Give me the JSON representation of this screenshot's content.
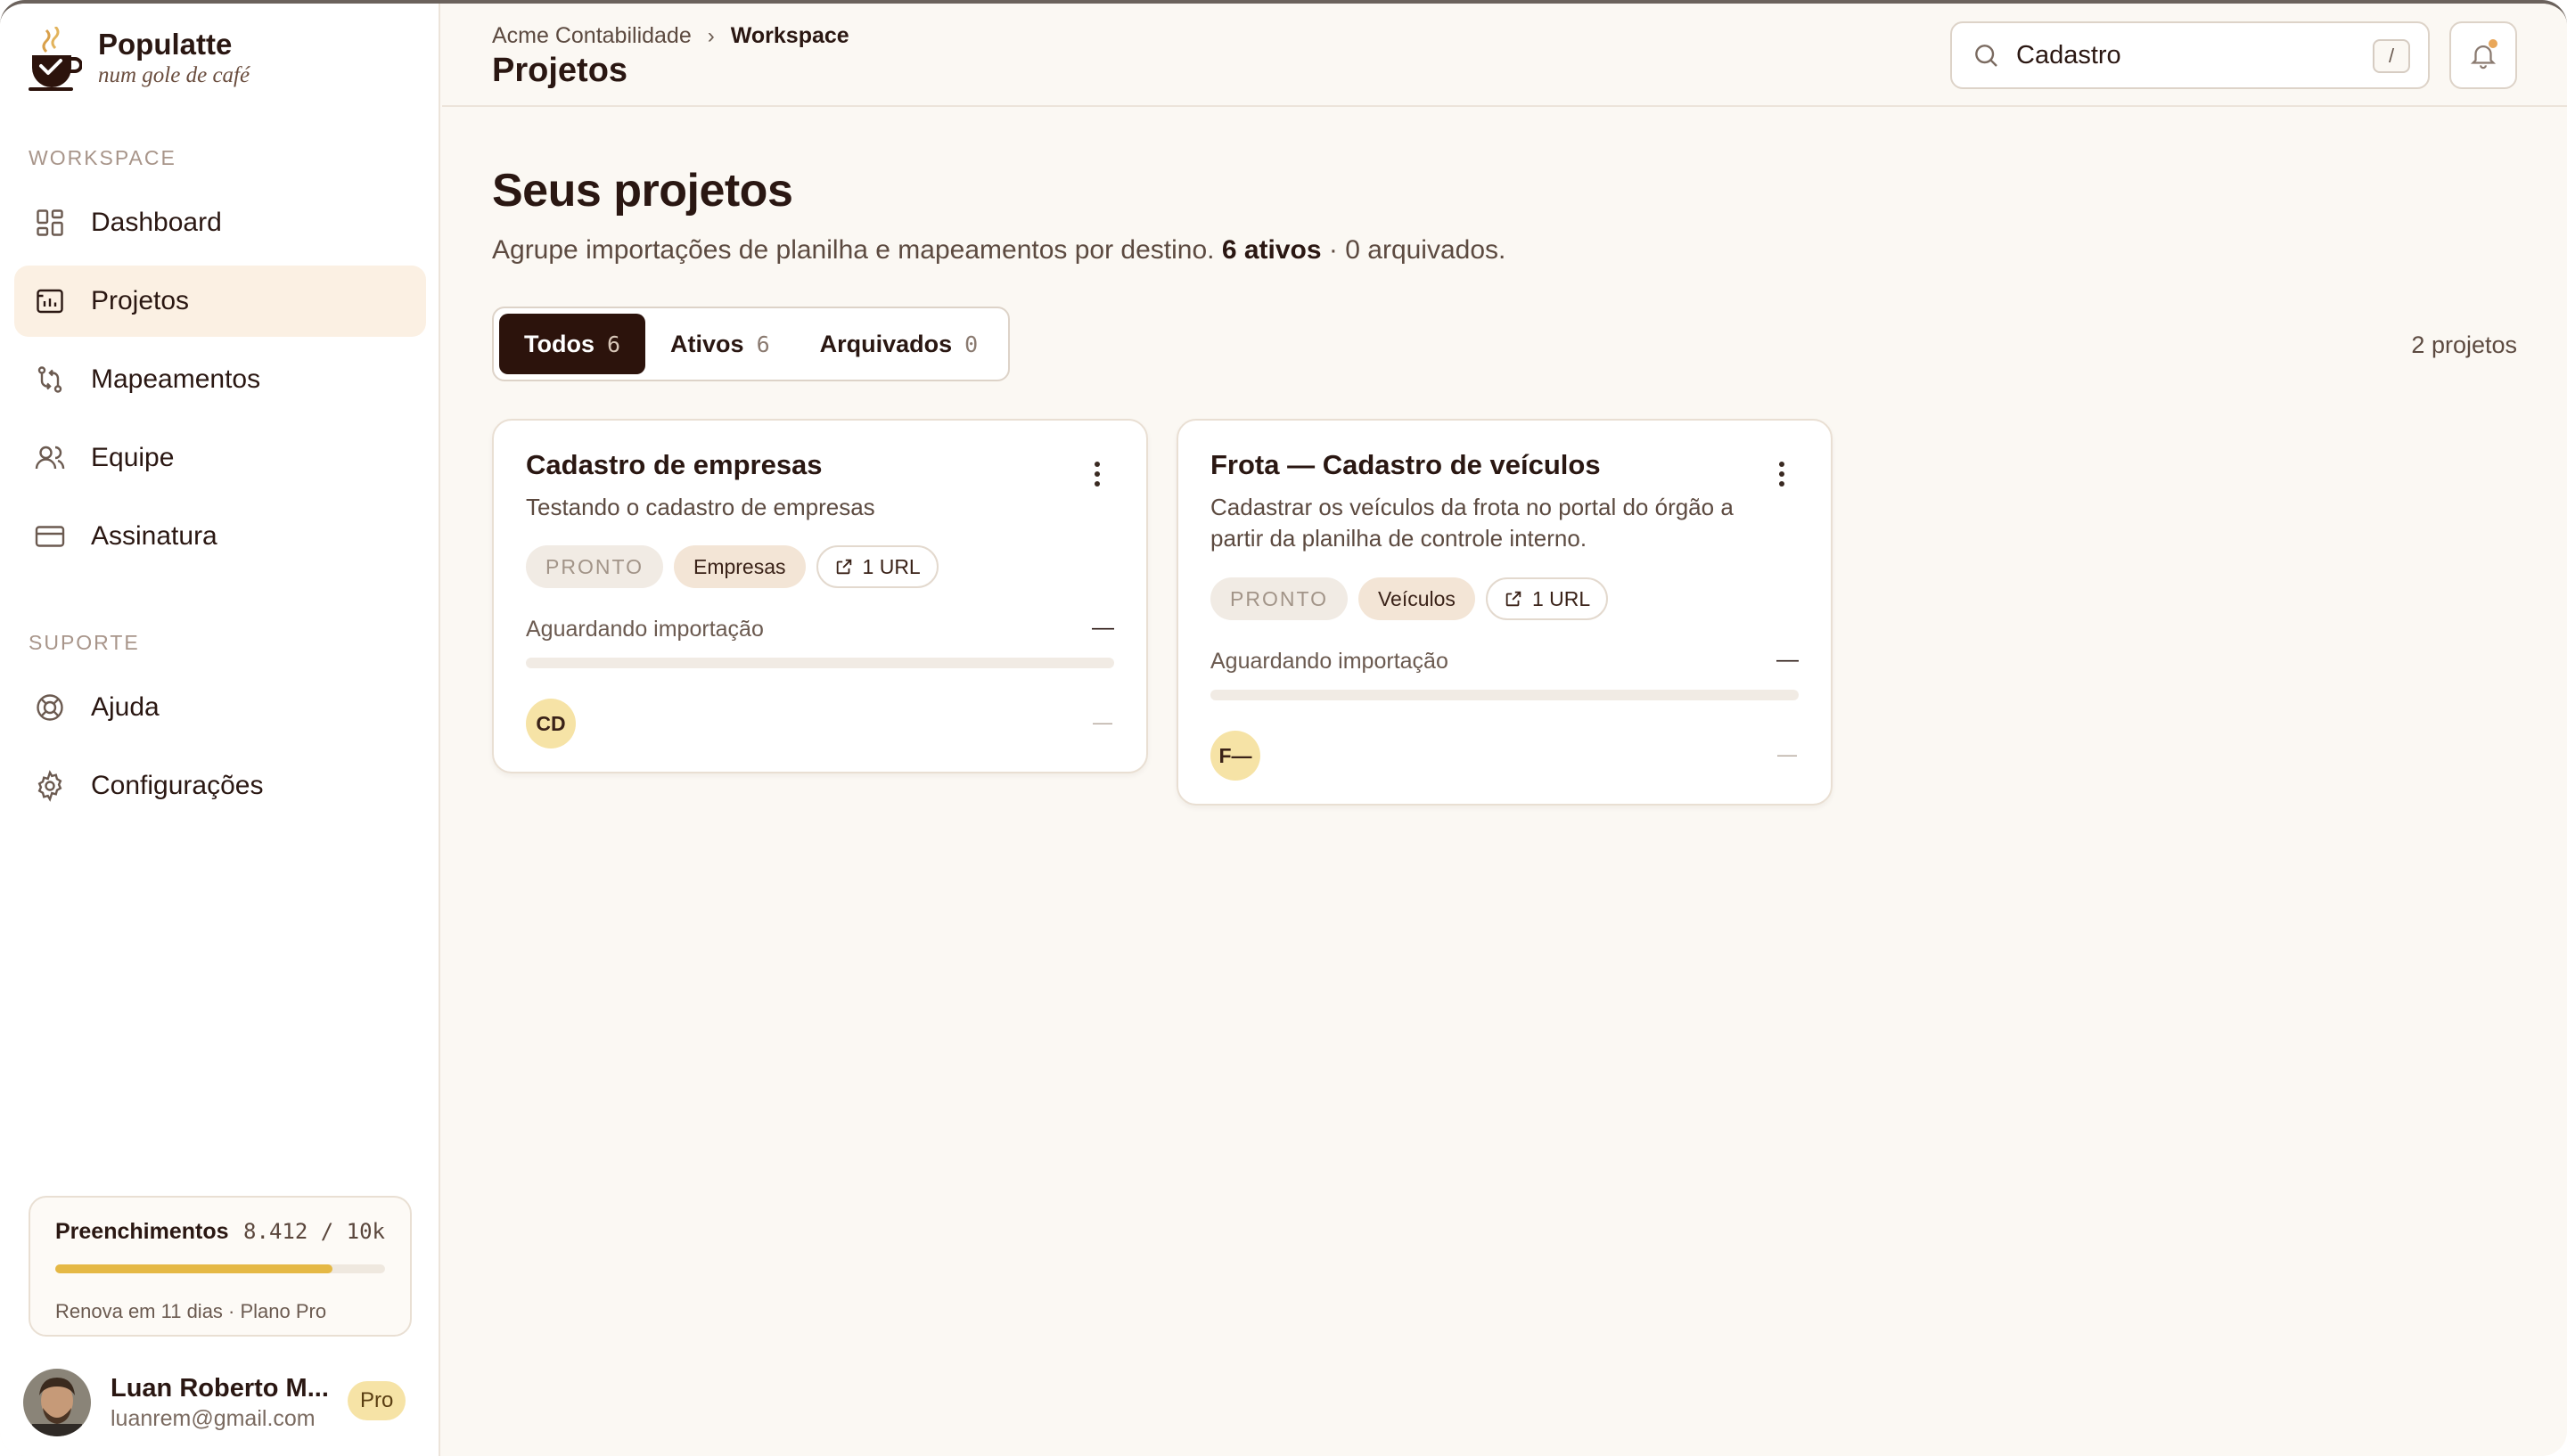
{
  "brand": {
    "name": "Populatte",
    "tagline": "num gole de café"
  },
  "sidebar": {
    "sections": [
      {
        "label": "WORKSPACE"
      },
      {
        "label": "SUPORTE"
      }
    ],
    "items": [
      {
        "label": "Dashboard",
        "icon": "dashboard-icon"
      },
      {
        "label": "Projetos",
        "icon": "projects-icon",
        "active": true
      },
      {
        "label": "Mapeamentos",
        "icon": "mappings-icon"
      },
      {
        "label": "Equipe",
        "icon": "team-icon"
      },
      {
        "label": "Assinatura",
        "icon": "credit-card-icon"
      },
      {
        "label": "Ajuda",
        "icon": "help-lifebuoy-icon"
      },
      {
        "label": "Configurações",
        "icon": "gear-icon"
      }
    ],
    "usage": {
      "title": "Preenchimentos",
      "count": "8.412 / 10k",
      "fraction": 0.8412,
      "footer": "Renova em 11 dias · Plano Pro"
    },
    "user": {
      "name": "Luan Roberto M...",
      "email": "luanrem@gmail.com",
      "badge": "Pro"
    }
  },
  "header": {
    "breadcrumb": {
      "parent": "Acme Contabilidade",
      "current": "Workspace"
    },
    "title": "Projetos",
    "search": {
      "value": "Cadastro",
      "shortcut": "/"
    }
  },
  "main": {
    "heading": "Seus projetos",
    "subtitle_prefix": "Agrupe importações de planilha e mapeamentos por destino.",
    "subtitle_active": "6 ativos",
    "subtitle_suffix": "· 0 arquivados.",
    "tabs": [
      {
        "label": "Todos",
        "count": "6",
        "active": true
      },
      {
        "label": "Ativos",
        "count": "6"
      },
      {
        "label": "Arquivados",
        "count": "0"
      }
    ],
    "result_count": "2 projetos",
    "projects": [
      {
        "title": "Cadastro de empresas",
        "description": "Testando o cadastro de empresas",
        "status": "PRONTO",
        "tag": "Empresas",
        "urls": "1 URL",
        "progress_label": "Aguardando importação",
        "progress_value": "—",
        "progress": 0,
        "initials": "CD",
        "footer": "—"
      },
      {
        "title": "Frota — Cadastro de veículos",
        "description": "Cadastrar os veículos da frota no portal do órgão a partir da planilha de controle interno.",
        "status": "PRONTO",
        "tag": "Veículos",
        "urls": "1 URL",
        "progress_label": "Aguardando importação",
        "progress_value": "—",
        "progress": 0,
        "initials": "F—",
        "footer": "—"
      }
    ]
  },
  "colors": {
    "accent_dark": "#2c130c",
    "active_nav_bg": "#fbf0e3",
    "usage_fill": "#e5b845",
    "badge_bg": "#f6e3a6"
  }
}
